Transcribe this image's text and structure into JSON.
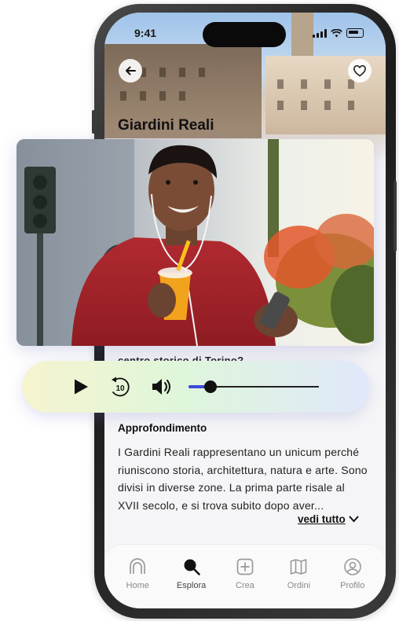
{
  "status": {
    "time": "9:41"
  },
  "place": {
    "title": "Giardini Reali"
  },
  "question_partial": "centro storico di Torino?",
  "player": {
    "progress_percent": 17,
    "skip_seconds": "10"
  },
  "details": {
    "heading": "Approfondimento",
    "text": "I Gardini Reali rappresentano un unicum perché riuniscono storia, architettura, natura e arte. Sono divisi in diverse zone. La prima parte risale al XVII secolo, e si trova subito dopo aver...",
    "more_label": "vedi tutto"
  },
  "tabs": [
    {
      "label": "Home",
      "icon": "arch-icon",
      "active": false
    },
    {
      "label": "Esplora",
      "icon": "search-icon",
      "active": true
    },
    {
      "label": "Crea",
      "icon": "plus-square-icon",
      "active": false
    },
    {
      "label": "Ordini",
      "icon": "map-icon",
      "active": false
    },
    {
      "label": "Profilo",
      "icon": "user-icon",
      "active": false
    }
  ],
  "colors": {
    "accent": "#3d49d9",
    "text": "#111111",
    "tab_inactive": "#8a8a8a"
  }
}
